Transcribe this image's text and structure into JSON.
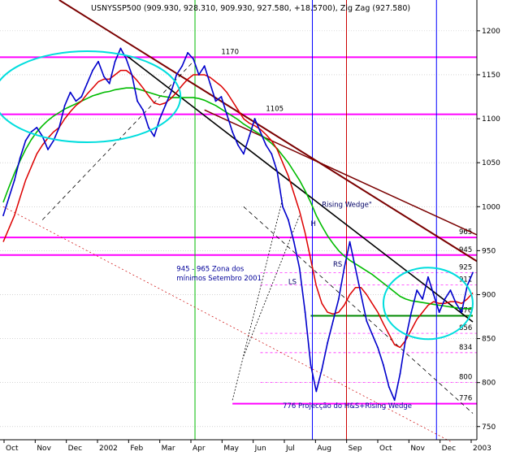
{
  "chart_data": {
    "type": "line",
    "title": "USNYSSP500 (909.930, 928.310, 909.930, 927.580, +18.5700), Zig Zag (927.580)",
    "ylim": [
      735,
      1235
    ],
    "y_ticks": [
      750,
      800,
      850,
      900,
      950,
      1000,
      1050,
      1100,
      1150,
      1200
    ],
    "x_ticks": [
      "Oct",
      "Nov",
      "Dec",
      "2002",
      "Feb",
      "Mar",
      "Apr",
      "May",
      "Jun",
      "Jul",
      "Aug",
      "Sep",
      "Oct",
      "Nov",
      "Dec",
      "2003"
    ],
    "series": [
      {
        "name": "",
        "values": [
          990,
          1010,
          1030,
          1055,
          1075,
          1085,
          1090,
          1080,
          1065,
          1075,
          1090,
          1115,
          1130,
          1120,
          1125,
          1140,
          1155,
          1165,
          1148,
          1140,
          1165,
          1180,
          1168,
          1150,
          1120,
          1110,
          1090,
          1080,
          1100,
          1115,
          1130,
          1150,
          1160,
          1175,
          1168,
          1150,
          1160,
          1140,
          1120,
          1125,
          1105,
          1085,
          1070,
          1060,
          1080,
          1100,
          1085,
          1070,
          1060,
          1040,
          1000,
          985,
          960,
          930,
          880,
          820,
          790,
          815,
          845,
          870,
          895,
          930,
          960,
          930,
          900,
          870,
          855,
          840,
          820,
          795,
          780,
          810,
          850,
          880,
          905,
          895,
          920,
          900,
          880,
          895,
          905,
          890,
          880,
          910,
          925
        ]
      },
      {
        "name": "",
        "values": [
          960,
          975,
          990,
          1010,
          1030,
          1045,
          1060,
          1070,
          1078,
          1085,
          1090,
          1100,
          1108,
          1115,
          1120,
          1128,
          1135,
          1142,
          1145,
          1145,
          1150,
          1155,
          1155,
          1150,
          1143,
          1135,
          1126,
          1118,
          1116,
          1118,
          1123,
          1130,
          1138,
          1145,
          1150,
          1150,
          1150,
          1147,
          1142,
          1137,
          1130,
          1120,
          1110,
          1100,
          1095,
          1092,
          1088,
          1082,
          1075,
          1065,
          1050,
          1035,
          1015,
          995,
          970,
          940,
          910,
          890,
          880,
          878,
          880,
          888,
          900,
          908,
          908,
          900,
          890,
          880,
          867,
          855,
          843,
          840,
          848,
          860,
          872,
          880,
          888,
          892,
          890,
          890,
          892,
          892,
          890,
          895,
          902
        ]
      },
      {
        "name": "",
        "values": [
          1005,
          1022,
          1038,
          1052,
          1065,
          1076,
          1085,
          1092,
          1098,
          1103,
          1107,
          1111,
          1114,
          1117,
          1120,
          1123,
          1126,
          1128,
          1130,
          1131,
          1133,
          1134,
          1135,
          1135,
          1134,
          1132,
          1130,
          1128,
          1126,
          1125,
          1124,
          1124,
          1124,
          1124,
          1124,
          1123,
          1121,
          1118,
          1115,
          1111,
          1107,
          1103,
          1099,
          1094,
          1090,
          1086,
          1082,
          1077,
          1072,
          1066,
          1058,
          1050,
          1040,
          1030,
          1018,
          1005,
          990,
          978,
          967,
          958,
          950,
          944,
          939,
          935,
          931,
          927,
          923,
          918,
          913,
          908,
          903,
          898,
          895,
          893,
          892,
          891,
          890,
          889,
          888,
          887,
          886,
          885,
          884,
          884,
          885
        ]
      }
    ],
    "horizontal_levels": [
      {
        "value": 1170,
        "label": "1170"
      },
      {
        "value": 1105,
        "label": "1105"
      },
      {
        "value": 965,
        "label": "965"
      },
      {
        "value": 945,
        "label": "945"
      },
      {
        "value": 925,
        "label": "925"
      },
      {
        "value": 911,
        "label": "911"
      },
      {
        "value": 876,
        "label": "876"
      },
      {
        "value": 856,
        "label": "856"
      },
      {
        "value": 834,
        "label": "834"
      },
      {
        "value": 800,
        "label": "800"
      },
      {
        "value": 776,
        "label": "776"
      }
    ],
    "annotations": [
      {
        "text": "Rising Wedge\"",
        "x": 57,
        "y": 1000
      },
      {
        "text": "H",
        "x": 55,
        "y": 978
      },
      {
        "text": "RS",
        "x": 59,
        "y": 932
      },
      {
        "text": "LS",
        "x": 51,
        "y": 912
      },
      {
        "text": "945 - 965 Zona dos",
        "x": 31,
        "y": 927
      },
      {
        "text": "mínimos Setembro 2001",
        "x": 31,
        "y": 916
      },
      {
        "text": "776 Projecção do H&S+Rising Wedge",
        "x": 50,
        "y": 771
      }
    ],
    "grid": true,
    "colors": {
      "price": "#0000cc",
      "ma_short": "#dd0000",
      "ma_long": "#00bb00",
      "resistance": "#ff00ff",
      "trendline_dark": "#7a0000",
      "ellipse": "#00dddd",
      "vertical_green": "#00bb00",
      "vertical_blue": "#0000ff",
      "vertical_red": "#cc0000",
      "projection": "#cc0000"
    }
  }
}
